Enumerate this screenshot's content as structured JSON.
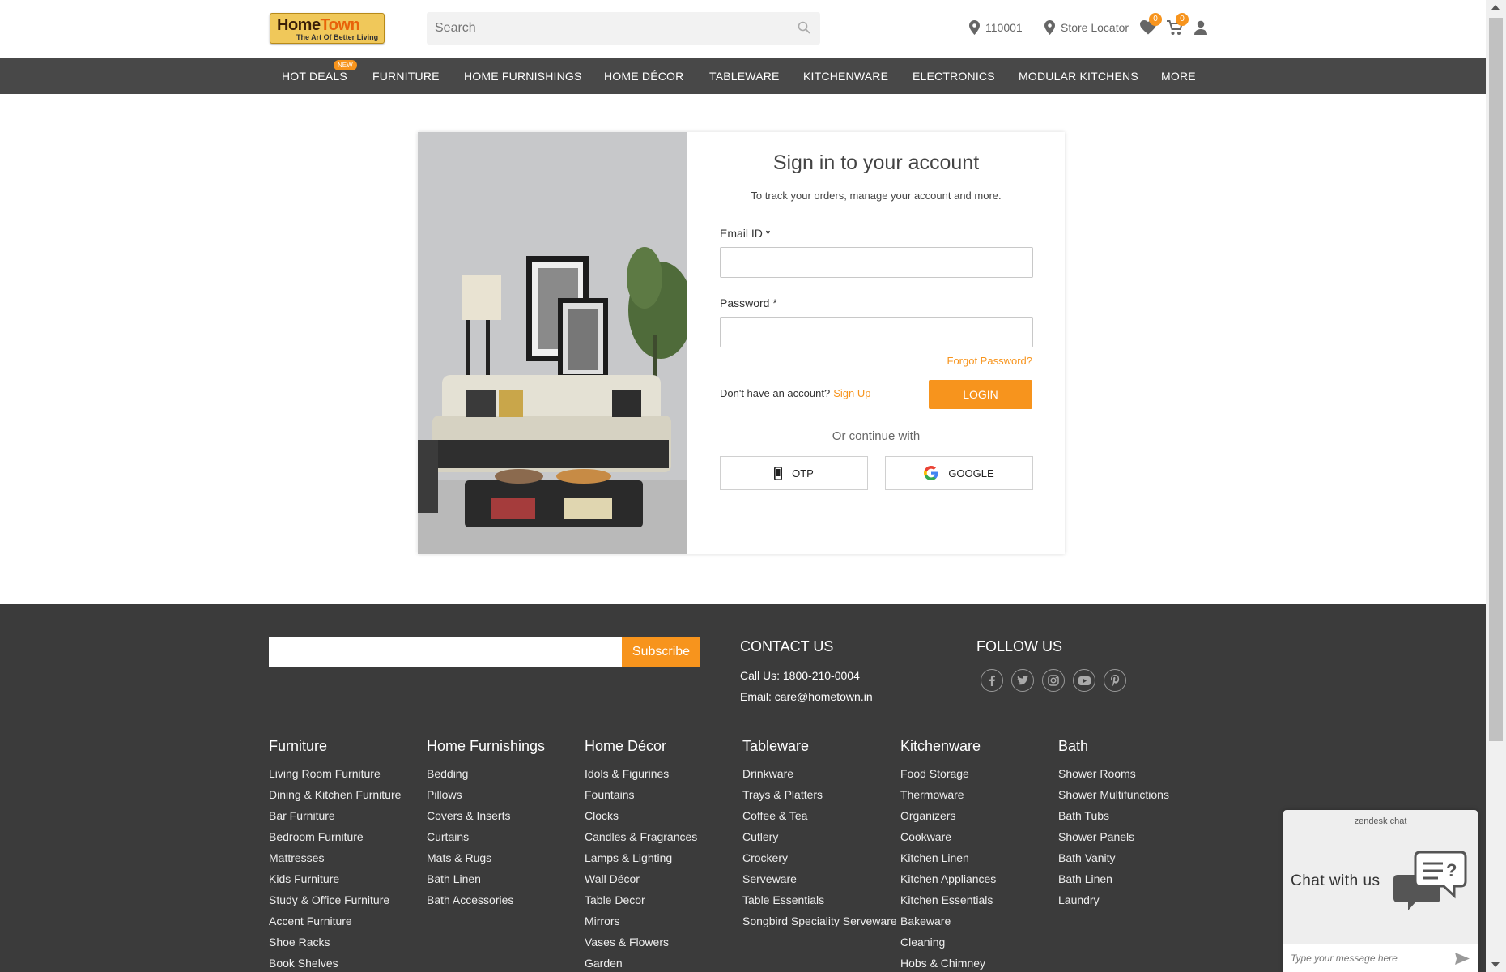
{
  "header": {
    "logo_main": "HomeTown",
    "logo_tagline": "The Art Of Better Living",
    "search_placeholder": "Search",
    "pincode": "110001",
    "store_locator": "Store Locator",
    "wishlist_count": "0",
    "cart_count": "0"
  },
  "nav": {
    "items": [
      "HOT DEALS",
      "FURNITURE",
      "HOME FURNISHINGS",
      "HOME DÉCOR",
      "TABLEWARE",
      "KITCHENWARE",
      "ELECTRONICS",
      "MODULAR KITCHENS",
      "MORE"
    ],
    "new_tag": "NEW"
  },
  "login": {
    "title": "Sign in to your account",
    "subtitle": "To track your orders, manage your account and more.",
    "email_label": "Email ID *",
    "password_label": "Password *",
    "forgot": "Forgot Password?",
    "no_account": "Don't have an account?",
    "sign_up": "Sign Up",
    "login_button": "LOGIN",
    "or_continue": "Or continue with",
    "otp_button": "OTP",
    "google_button": "GOOGLE"
  },
  "footer": {
    "subscribe_button": "Subscribe",
    "contact_title": "CONTACT US",
    "call_us": "Call Us: 1800-210-0004",
    "email": "Email: care@hometown.in",
    "follow_title": "FOLLOW US",
    "columns": [
      {
        "title": "Furniture",
        "items": [
          "Living Room Furniture",
          "Dining & Kitchen Furniture",
          "Bar Furniture",
          "Bedroom Furniture",
          "Mattresses",
          "Kids Furniture",
          "Study & Office Furniture",
          "Accent Furniture",
          "Shoe Racks",
          "Book Shelves"
        ]
      },
      {
        "title": "Home Furnishings",
        "items": [
          "Bedding",
          "Pillows",
          "Covers & Inserts",
          "Curtains",
          "Mats & Rugs",
          "Bath Linen",
          "Bath Accessories"
        ]
      },
      {
        "title": "Home Décor",
        "items": [
          "Idols & Figurines",
          "Fountains",
          "Clocks",
          "Candles & Fragrances",
          "Lamps & Lighting",
          "Wall Décor",
          "Table Decor",
          "Mirrors",
          "Vases & Flowers",
          "Garden"
        ]
      },
      {
        "title": "Tableware",
        "items": [
          "Drinkware",
          "Trays & Platters",
          "Coffee & Tea",
          "Cutlery",
          "Crockery",
          "Serveware",
          "Table Essentials",
          "Songbird Speciality Serveware"
        ]
      },
      {
        "title": "Kitchenware",
        "items": [
          "Food Storage",
          "Thermoware",
          "Organizers",
          "Cookware",
          "Kitchen Linen",
          "Kitchen Appliances",
          "Kitchen Essentials",
          "Bakeware",
          "Cleaning",
          "Hobs & Chimney"
        ]
      },
      {
        "title": "Bath",
        "items": [
          "Shower Rooms",
          "Shower Multifunctions",
          "Bath Tubs",
          "Shower Panels",
          "Bath Vanity",
          "Bath Linen",
          "Laundry"
        ]
      }
    ]
  },
  "chat": {
    "brand": "zendesk chat",
    "label": "Chat with us",
    "placeholder": "Type your message here"
  },
  "colors": {
    "accent": "#f7941d",
    "nav_bg": "#484848",
    "footer_bg": "#3b3b3b"
  }
}
